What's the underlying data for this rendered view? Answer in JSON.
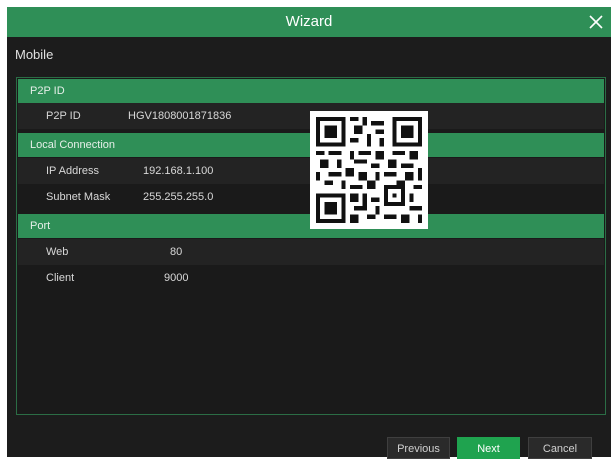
{
  "window": {
    "title": "Wizard"
  },
  "page": {
    "section_title": "Mobile"
  },
  "groups": {
    "p2p": {
      "header": "P2P ID",
      "rows": [
        {
          "label": "P2P ID",
          "value": "HGV1808001871836"
        }
      ]
    },
    "local": {
      "header": "Local Connection",
      "rows": [
        {
          "label": "IP Address",
          "value": "192.168.1.100"
        },
        {
          "label": "Subnet Mask",
          "value": "255.255.255.0"
        }
      ]
    },
    "port": {
      "header": "Port",
      "rows": [
        {
          "label": "Web",
          "value": "80"
        },
        {
          "label": "Client",
          "value": "9000"
        }
      ]
    }
  },
  "buttons": {
    "previous": "Previous",
    "next": "Next",
    "cancel": "Cancel"
  },
  "icons": {
    "close": "close-icon",
    "qr": "qr-code-icon"
  },
  "colors": {
    "accent": "#2f8f57",
    "primary_button": "#1fa34f",
    "background": "#1c1c1c"
  }
}
